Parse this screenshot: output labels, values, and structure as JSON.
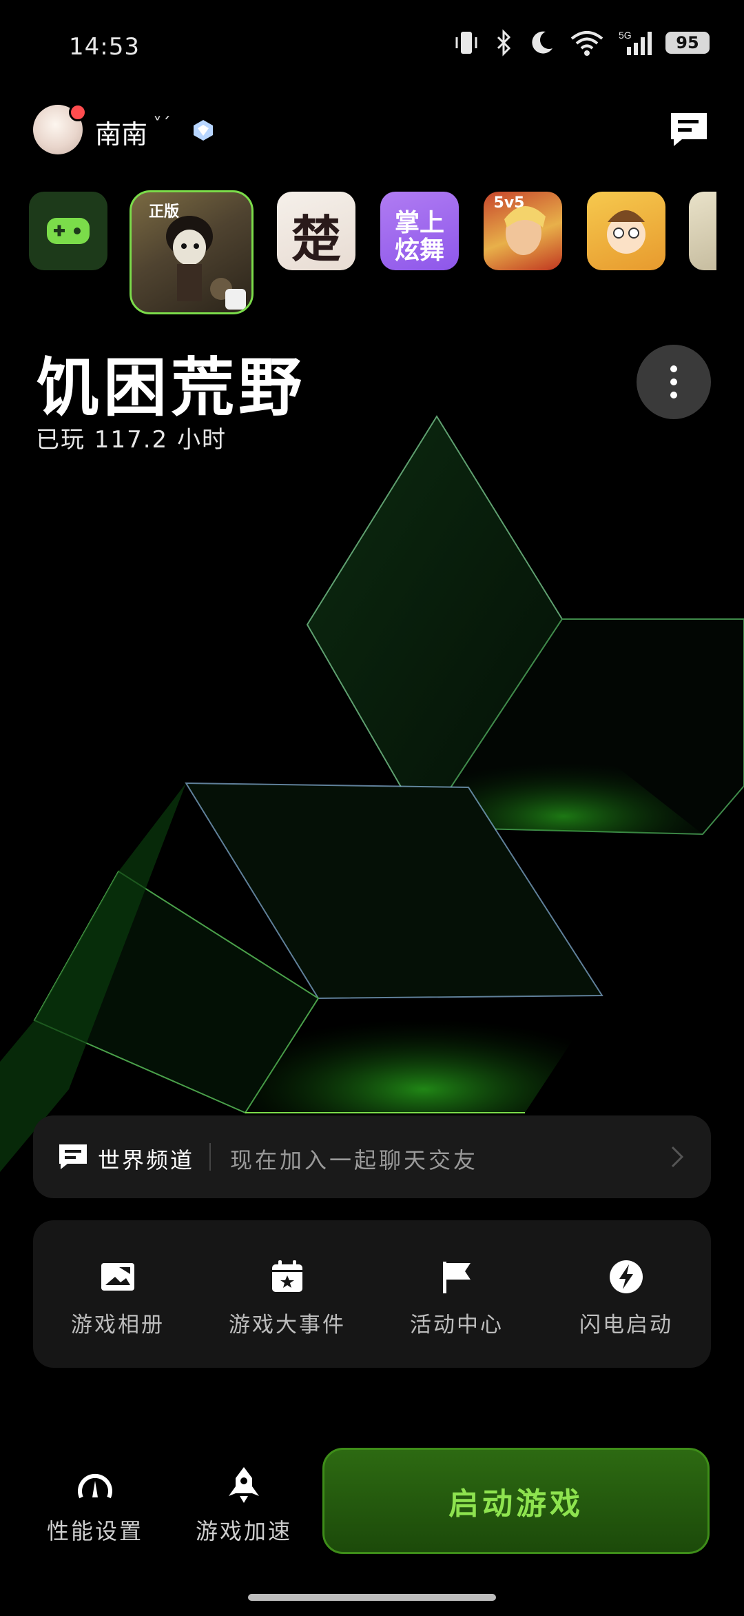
{
  "status_bar": {
    "time": "14:53",
    "battery": "95",
    "network": "5G"
  },
  "header": {
    "username": "南南",
    "chevron": "˅ˊ"
  },
  "games": {
    "selected": {
      "badge": "正版"
    },
    "chu": {
      "text": "楚"
    },
    "dance": {
      "line1": "掌上",
      "line2": "炫舞"
    },
    "kings": {
      "badge": "5v5"
    }
  },
  "current_game": {
    "title": "饥困荒野",
    "play_time": "已玩 117.2 小时"
  },
  "world_channel": {
    "title": "世界频道",
    "subtitle": "现在加入一起聊天交友"
  },
  "actions": [
    {
      "label": "游戏相册",
      "icon": "album-icon"
    },
    {
      "label": "游戏大事件",
      "icon": "calendar-star-icon"
    },
    {
      "label": "活动中心",
      "icon": "flag-icon"
    },
    {
      "label": "闪电启动",
      "icon": "lightning-icon"
    }
  ],
  "bottom_bar": {
    "performance": "性能设置",
    "accelerate": "游戏加速",
    "launch": "启动游戏"
  },
  "colors": {
    "accent_green": "#7bdc4a",
    "launch_text": "#8ee34f"
  }
}
